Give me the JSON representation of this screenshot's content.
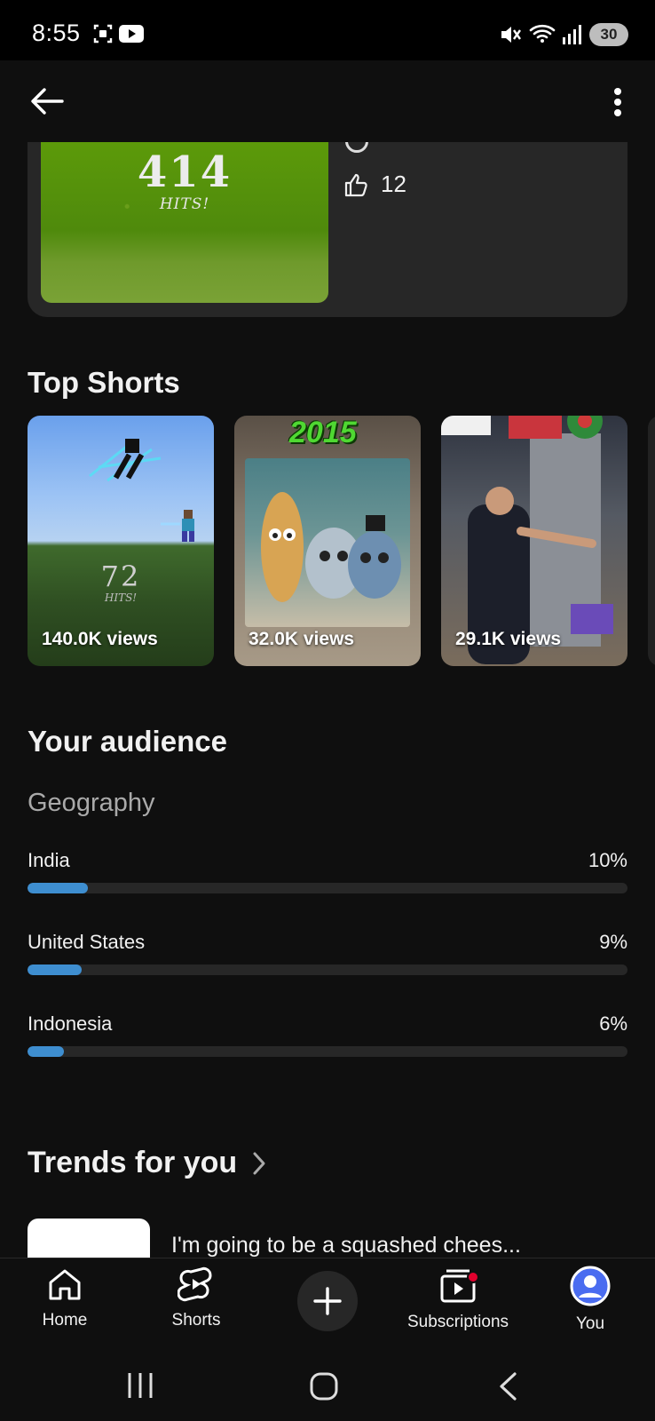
{
  "status_bar": {
    "time": "8:55",
    "battery": "30"
  },
  "video_card": {
    "thumbnail_counter": "414",
    "thumbnail_caption": "HITS!",
    "likes": "12"
  },
  "top_shorts": {
    "title": "Top Shorts",
    "items": [
      {
        "views": "140.0K views",
        "overlay_number": "72",
        "overlay_caption": "HITS!"
      },
      {
        "views": "32.0K views",
        "overlay_text": "2015"
      },
      {
        "views": "29.1K views"
      }
    ]
  },
  "audience": {
    "title": "Your audience",
    "geography_label": "Geography",
    "countries": [
      {
        "name": "India",
        "percent_label": "10%",
        "share": 0.1
      },
      {
        "name": "United States",
        "percent_label": "9%",
        "share": 0.09
      },
      {
        "name": "Indonesia",
        "percent_label": "6%",
        "share": 0.06
      }
    ]
  },
  "trends": {
    "title": "Trends for you",
    "first_item_title": "I'm going to be a squashed chees..."
  },
  "bottom_nav": {
    "home": "Home",
    "shorts": "Shorts",
    "subscriptions": "Subscriptions",
    "you": "You"
  },
  "colors": {
    "accent_bar": "#3e8ed0",
    "notification_dot": "#e1002d",
    "avatar": "#4a6cf0"
  },
  "icons": [
    "screen-record-icon",
    "youtube-icon",
    "mute-icon",
    "wifi-icon",
    "signal-icon",
    "back-arrow-icon",
    "more-vert-icon",
    "thumb-up-icon",
    "chevron-right-icon",
    "home-icon",
    "shorts-icon",
    "plus-icon",
    "subscriptions-icon",
    "avatar-icon",
    "recents-icon",
    "home-circle-icon",
    "back-chevron-icon"
  ]
}
